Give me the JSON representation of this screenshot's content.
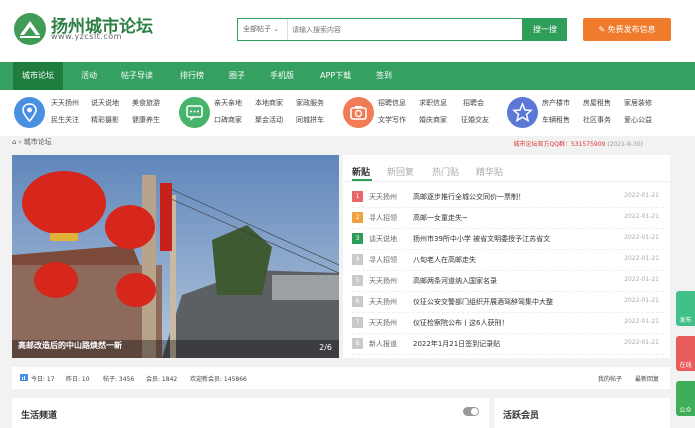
{
  "site": {
    "name": "扬州城市论坛",
    "url": "www.yzcslt.com"
  },
  "search": {
    "category": "全部帖子",
    "placeholder": "请输入搜索内容",
    "button": "搜一搜"
  },
  "post_button": "免费发布信息",
  "nav": [
    "城市论坛",
    "活动",
    "帖子导读",
    "排行榜",
    "圈子",
    "手机版",
    "APP下载",
    "签到"
  ],
  "categories": [
    {
      "links": [
        "天天扬州",
        "说天说地",
        "美食旅游",
        "民生关注",
        "精彩摄影",
        "健康养生"
      ],
      "color": "#4a90e2",
      "icon": "location-icon"
    },
    {
      "links": [
        "亲天亲地",
        "本地商家",
        "家政服务",
        "口碑商家",
        "聚会活动",
        "同城拼车"
      ],
      "color": "#47b36b",
      "icon": "chat-icon"
    },
    {
      "links": [
        "招聘信息",
        "求职信息",
        "招聘会",
        "文学写作",
        "婚庆商家",
        "征婚交友"
      ],
      "color": "#f07b55",
      "icon": "camera-icon"
    },
    {
      "links": [
        "房产楼市",
        "房屋租售",
        "家居装修",
        "车辆租售",
        "社区事务",
        "爱心公益"
      ],
      "color": "#5b78d6",
      "icon": "star-icon"
    }
  ],
  "breadcrumb": "城市论坛",
  "qq": {
    "label": "城市论坛官方QQ群：531575909",
    "date": "(2021-9-30)"
  },
  "banner": {
    "caption": "高邮改造后的中山路焕然一新",
    "pager": "2/6"
  },
  "tabs": [
    "新贴",
    "新回复",
    "热门贴",
    "精华贴"
  ],
  "posts": [
    {
      "num": "1",
      "color": "#e96767",
      "cat": "天天扬州",
      "title": "高邮逐步推行全城公交同价一票制！",
      "date": "2022-01-21"
    },
    {
      "num": "2",
      "color": "#f0a23c",
      "cat": "寻人招领",
      "title": "高邮一女童走失~",
      "date": "2022-01-21"
    },
    {
      "num": "3",
      "color": "#2f9d5a",
      "cat": "谈天说地",
      "title": "扬州市39所中小学 被省文明委授予江苏省文",
      "date": "2022-01-21"
    },
    {
      "num": "4",
      "color": "#c9c9c9",
      "cat": "寻人招领",
      "title": "八旬老人在高邮走失",
      "date": "2022-01-21"
    },
    {
      "num": "5",
      "color": "#c9c9c9",
      "cat": "天天扬州",
      "title": "高邮两条河道纳入国家名录",
      "date": "2022-01-21"
    },
    {
      "num": "6",
      "color": "#c9c9c9",
      "cat": "天天扬州",
      "title": "仪征公安交警部门组织开展酒驾醉驾集中大整",
      "date": "2022-01-21"
    },
    {
      "num": "7",
      "color": "#c9c9c9",
      "cat": "天天扬州",
      "title": "仪征检察院公布丨这6人获刑！",
      "date": "2022-01-21"
    },
    {
      "num": "8",
      "color": "#c9c9c9",
      "cat": "新人报道",
      "title": "2022年1月21日签到记录贴",
      "date": "2022-01-21"
    }
  ],
  "stats": {
    "today": "今日: 17",
    "yesterday": "昨日: 10",
    "threads": "帖子: 3456",
    "members": "会员: 1842",
    "welcome": "欢迎新会员: 145866",
    "my_posts": "我的帖子",
    "latest_reply": "最新回复"
  },
  "panels": {
    "life": "生活频道",
    "active": "活跃会员"
  },
  "side_buttons": [
    {
      "label": "发布",
      "color": "#41c08a"
    },
    {
      "label": "在线",
      "color": "#e95c5c"
    },
    {
      "label": "公众",
      "color": "#3fae5a"
    }
  ]
}
